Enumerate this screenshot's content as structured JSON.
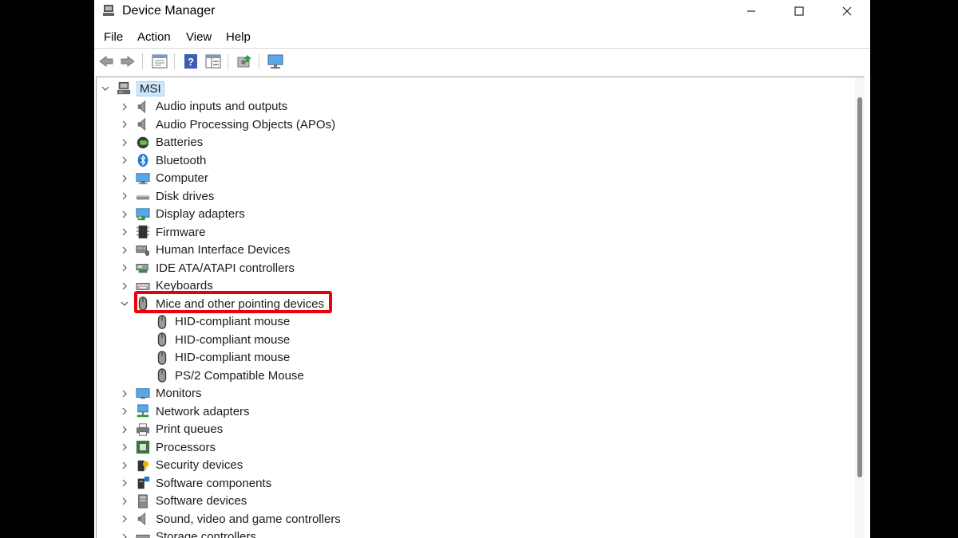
{
  "window": {
    "title": "Device Manager"
  },
  "menu": [
    "File",
    "Action",
    "View",
    "Help"
  ],
  "toolbar": {
    "icons": [
      "back-icon",
      "forward-icon",
      "properties-icon",
      "help-icon",
      "show-hide-console-tree-icon",
      "update-driver-icon",
      "scan-hardware-icon"
    ]
  },
  "tree": {
    "root": "MSI",
    "categories": [
      {
        "label": "Audio inputs and outputs",
        "icon": "speaker-icon",
        "expanded": false
      },
      {
        "label": "Audio Processing Objects (APOs)",
        "icon": "speaker-icon",
        "expanded": false
      },
      {
        "label": "Batteries",
        "icon": "battery-icon",
        "expanded": false
      },
      {
        "label": "Bluetooth",
        "icon": "bluetooth-icon",
        "expanded": false
      },
      {
        "label": "Computer",
        "icon": "computer-icon",
        "expanded": false
      },
      {
        "label": "Disk drives",
        "icon": "disk-drive-icon",
        "expanded": false
      },
      {
        "label": "Display adapters",
        "icon": "display-adapter-icon",
        "expanded": false
      },
      {
        "label": "Firmware",
        "icon": "firmware-icon",
        "expanded": false
      },
      {
        "label": "Human Interface Devices",
        "icon": "hid-icon",
        "expanded": false
      },
      {
        "label": "IDE ATA/ATAPI controllers",
        "icon": "ide-controller-icon",
        "expanded": false
      },
      {
        "label": "Keyboards",
        "icon": "keyboard-icon",
        "expanded": false
      },
      {
        "label": "Mice and other pointing devices",
        "icon": "mouse-icon",
        "expanded": true,
        "children": [
          "HID-compliant mouse",
          "HID-compliant mouse",
          "HID-compliant mouse",
          "PS/2 Compatible Mouse"
        ]
      },
      {
        "label": "Monitors",
        "icon": "monitor-icon",
        "expanded": false
      },
      {
        "label": "Network adapters",
        "icon": "network-adapter-icon",
        "expanded": false
      },
      {
        "label": "Print queues",
        "icon": "printer-icon",
        "expanded": false
      },
      {
        "label": "Processors",
        "icon": "processor-icon",
        "expanded": false
      },
      {
        "label": "Security devices",
        "icon": "security-device-icon",
        "expanded": false
      },
      {
        "label": "Software components",
        "icon": "software-component-icon",
        "expanded": false
      },
      {
        "label": "Software devices",
        "icon": "software-device-icon",
        "expanded": false
      },
      {
        "label": "Sound, video and game controllers",
        "icon": "speaker-icon",
        "expanded": false
      },
      {
        "label": "Storage controllers",
        "icon": "storage-controller-icon",
        "expanded": false
      }
    ]
  },
  "annotation": {
    "highlight_color": "#e8000b",
    "highlighted_item": "Mice and other pointing devices"
  }
}
